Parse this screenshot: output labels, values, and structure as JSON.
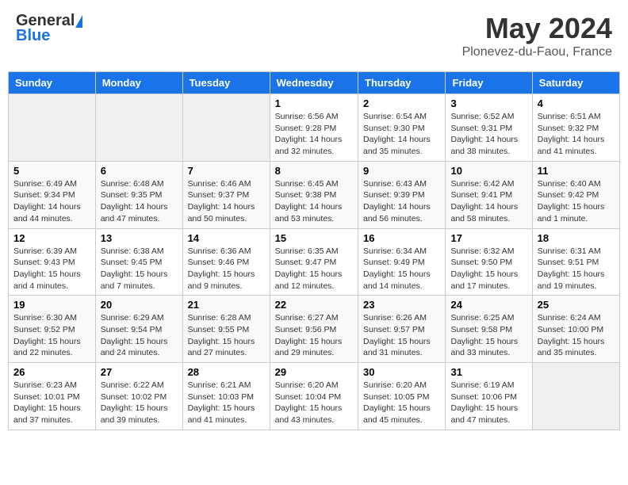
{
  "header": {
    "logo_general": "General",
    "logo_blue": "Blue",
    "month": "May 2024",
    "location": "Plonevez-du-Faou, France"
  },
  "days_of_week": [
    "Sunday",
    "Monday",
    "Tuesday",
    "Wednesday",
    "Thursday",
    "Friday",
    "Saturday"
  ],
  "weeks": [
    [
      {
        "day": "",
        "info": ""
      },
      {
        "day": "",
        "info": ""
      },
      {
        "day": "",
        "info": ""
      },
      {
        "day": "1",
        "info": "Sunrise: 6:56 AM\nSunset: 9:28 PM\nDaylight: 14 hours\nand 32 minutes."
      },
      {
        "day": "2",
        "info": "Sunrise: 6:54 AM\nSunset: 9:30 PM\nDaylight: 14 hours\nand 35 minutes."
      },
      {
        "day": "3",
        "info": "Sunrise: 6:52 AM\nSunset: 9:31 PM\nDaylight: 14 hours\nand 38 minutes."
      },
      {
        "day": "4",
        "info": "Sunrise: 6:51 AM\nSunset: 9:32 PM\nDaylight: 14 hours\nand 41 minutes."
      }
    ],
    [
      {
        "day": "5",
        "info": "Sunrise: 6:49 AM\nSunset: 9:34 PM\nDaylight: 14 hours\nand 44 minutes."
      },
      {
        "day": "6",
        "info": "Sunrise: 6:48 AM\nSunset: 9:35 PM\nDaylight: 14 hours\nand 47 minutes."
      },
      {
        "day": "7",
        "info": "Sunrise: 6:46 AM\nSunset: 9:37 PM\nDaylight: 14 hours\nand 50 minutes."
      },
      {
        "day": "8",
        "info": "Sunrise: 6:45 AM\nSunset: 9:38 PM\nDaylight: 14 hours\nand 53 minutes."
      },
      {
        "day": "9",
        "info": "Sunrise: 6:43 AM\nSunset: 9:39 PM\nDaylight: 14 hours\nand 56 minutes."
      },
      {
        "day": "10",
        "info": "Sunrise: 6:42 AM\nSunset: 9:41 PM\nDaylight: 14 hours\nand 58 minutes."
      },
      {
        "day": "11",
        "info": "Sunrise: 6:40 AM\nSunset: 9:42 PM\nDaylight: 15 hours\nand 1 minute."
      }
    ],
    [
      {
        "day": "12",
        "info": "Sunrise: 6:39 AM\nSunset: 9:43 PM\nDaylight: 15 hours\nand 4 minutes."
      },
      {
        "day": "13",
        "info": "Sunrise: 6:38 AM\nSunset: 9:45 PM\nDaylight: 15 hours\nand 7 minutes."
      },
      {
        "day": "14",
        "info": "Sunrise: 6:36 AM\nSunset: 9:46 PM\nDaylight: 15 hours\nand 9 minutes."
      },
      {
        "day": "15",
        "info": "Sunrise: 6:35 AM\nSunset: 9:47 PM\nDaylight: 15 hours\nand 12 minutes."
      },
      {
        "day": "16",
        "info": "Sunrise: 6:34 AM\nSunset: 9:49 PM\nDaylight: 15 hours\nand 14 minutes."
      },
      {
        "day": "17",
        "info": "Sunrise: 6:32 AM\nSunset: 9:50 PM\nDaylight: 15 hours\nand 17 minutes."
      },
      {
        "day": "18",
        "info": "Sunrise: 6:31 AM\nSunset: 9:51 PM\nDaylight: 15 hours\nand 19 minutes."
      }
    ],
    [
      {
        "day": "19",
        "info": "Sunrise: 6:30 AM\nSunset: 9:52 PM\nDaylight: 15 hours\nand 22 minutes."
      },
      {
        "day": "20",
        "info": "Sunrise: 6:29 AM\nSunset: 9:54 PM\nDaylight: 15 hours\nand 24 minutes."
      },
      {
        "day": "21",
        "info": "Sunrise: 6:28 AM\nSunset: 9:55 PM\nDaylight: 15 hours\nand 27 minutes."
      },
      {
        "day": "22",
        "info": "Sunrise: 6:27 AM\nSunset: 9:56 PM\nDaylight: 15 hours\nand 29 minutes."
      },
      {
        "day": "23",
        "info": "Sunrise: 6:26 AM\nSunset: 9:57 PM\nDaylight: 15 hours\nand 31 minutes."
      },
      {
        "day": "24",
        "info": "Sunrise: 6:25 AM\nSunset: 9:58 PM\nDaylight: 15 hours\nand 33 minutes."
      },
      {
        "day": "25",
        "info": "Sunrise: 6:24 AM\nSunset: 10:00 PM\nDaylight: 15 hours\nand 35 minutes."
      }
    ],
    [
      {
        "day": "26",
        "info": "Sunrise: 6:23 AM\nSunset: 10:01 PM\nDaylight: 15 hours\nand 37 minutes."
      },
      {
        "day": "27",
        "info": "Sunrise: 6:22 AM\nSunset: 10:02 PM\nDaylight: 15 hours\nand 39 minutes."
      },
      {
        "day": "28",
        "info": "Sunrise: 6:21 AM\nSunset: 10:03 PM\nDaylight: 15 hours\nand 41 minutes."
      },
      {
        "day": "29",
        "info": "Sunrise: 6:20 AM\nSunset: 10:04 PM\nDaylight: 15 hours\nand 43 minutes."
      },
      {
        "day": "30",
        "info": "Sunrise: 6:20 AM\nSunset: 10:05 PM\nDaylight: 15 hours\nand 45 minutes."
      },
      {
        "day": "31",
        "info": "Sunrise: 6:19 AM\nSunset: 10:06 PM\nDaylight: 15 hours\nand 47 minutes."
      },
      {
        "day": "",
        "info": ""
      }
    ]
  ]
}
